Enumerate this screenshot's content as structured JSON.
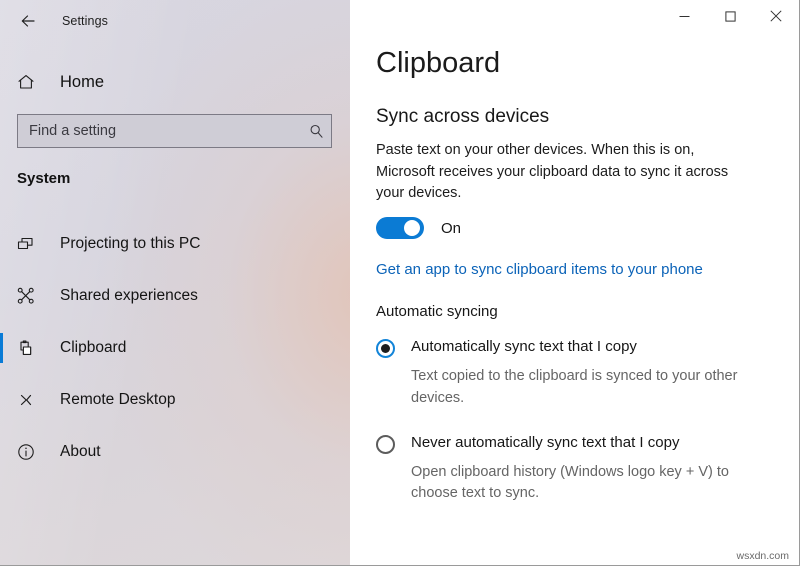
{
  "window": {
    "app_title": "Settings",
    "back_icon": "back-arrow-icon",
    "controls": {
      "minimize": "minimize-icon",
      "maximize": "maximize-icon",
      "close": "close-icon"
    }
  },
  "sidebar": {
    "home_label": "Home",
    "home_icon": "home-icon",
    "search": {
      "placeholder": "Find a setting",
      "value": "",
      "icon": "search-icon"
    },
    "group_header": "System",
    "items": [
      {
        "label": "Projecting to this PC",
        "icon": "project-screen-icon",
        "selected": false
      },
      {
        "label": "Shared experiences",
        "icon": "share-nodes-icon",
        "selected": false
      },
      {
        "label": "Clipboard",
        "icon": "clipboard-icon",
        "selected": true
      },
      {
        "label": "Remote Desktop",
        "icon": "remote-desktop-icon",
        "selected": false
      },
      {
        "label": "About",
        "icon": "info-circle-icon",
        "selected": false
      }
    ]
  },
  "main": {
    "page_title": "Clipboard",
    "section_title": "Sync across devices",
    "description": "Paste text on your other devices. When this is on, Microsoft receives your clipboard data to sync it across your devices.",
    "toggle": {
      "state_label": "On",
      "checked": true
    },
    "link_label": "Get an app to sync clipboard items to your phone",
    "sub_heading": "Automatic syncing",
    "radio_options": [
      {
        "label": "Automatically sync text that I copy",
        "description": "Text copied to the clipboard is synced to your other devices.",
        "checked": true
      },
      {
        "label": "Never automatically sync text that I copy",
        "description": "Open clipboard history (Windows logo key + V) to choose text to sync.",
        "checked": false
      }
    ]
  },
  "watermark": "wsxdn.com",
  "colors": {
    "accent_blue": "#0a7bd6",
    "link_blue": "#0b63b8",
    "toggle_on": "#0b7bd4",
    "radio_checked_ring": "#1284d8"
  }
}
